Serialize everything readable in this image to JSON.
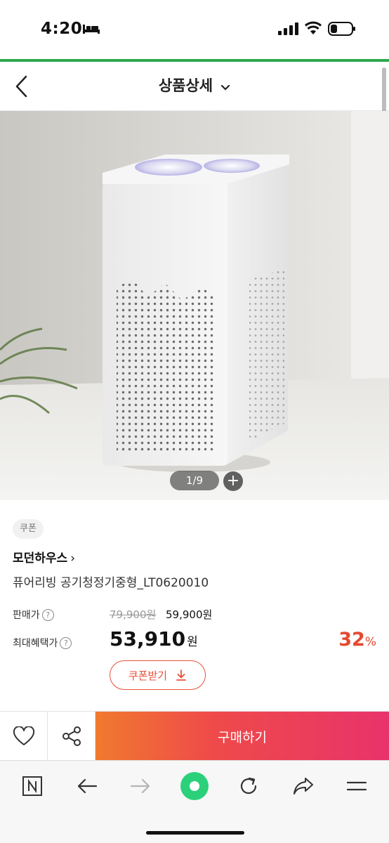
{
  "status_bar": {
    "time": "4:20"
  },
  "header": {
    "title": "상품상세"
  },
  "gallery": {
    "counter": "1/9",
    "zoom_label": "+"
  },
  "product": {
    "coupon_tag": "쿠폰",
    "brand": "모던하우스",
    "brand_chevron": "›",
    "name": "퓨어리빙 공기청정기중형_LT0620010"
  },
  "pricing": {
    "price_label": "판매가",
    "original_price": "79,900원",
    "sale_price": "59,900원",
    "benefit_label": "최대혜택가",
    "benefit_price": "53,910",
    "benefit_unit": "원",
    "discount_value": "32",
    "discount_unit": "%",
    "help_symbol": "?"
  },
  "coupon_button": {
    "label": "쿠폰받기"
  },
  "action_bar": {
    "buy_label": "구매하기"
  },
  "colors": {
    "accent": "#e8503a",
    "progress": "#2fa84f",
    "home_dot": "#2bd17a"
  }
}
